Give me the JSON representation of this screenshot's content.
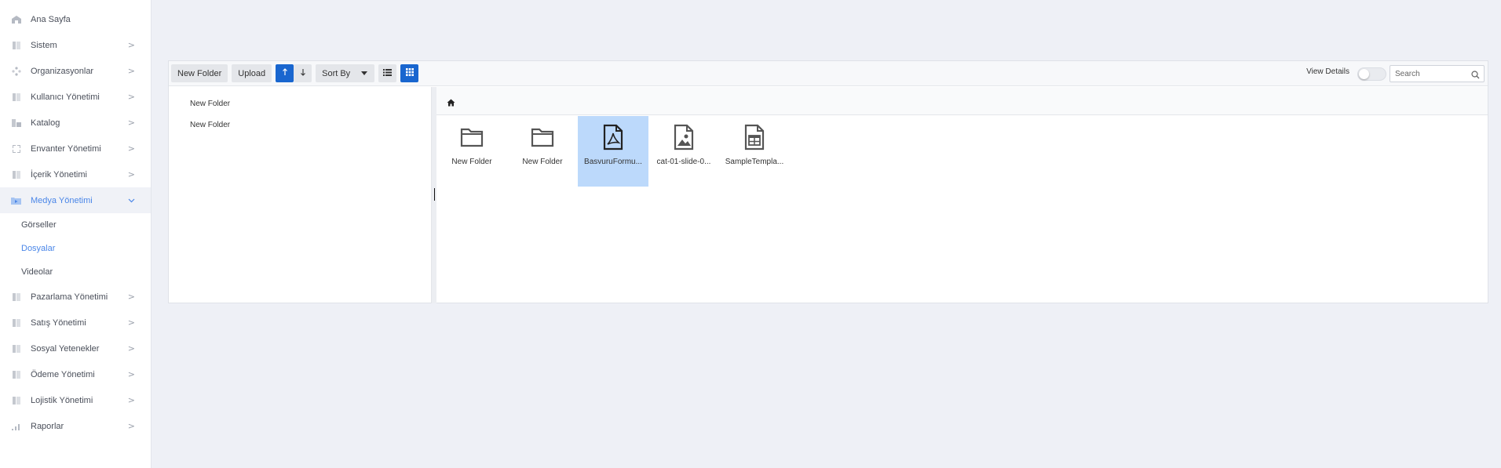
{
  "sidebar": {
    "items": [
      {
        "label": "Ana Sayfa",
        "icon": "home-icon",
        "chevron": ""
      },
      {
        "label": "Sistem",
        "icon": "system-icon",
        "chevron": ">"
      },
      {
        "label": "Organizasyonlar",
        "icon": "organization-icon",
        "chevron": ">"
      },
      {
        "label": "Kullanıcı Yönetimi",
        "icon": "users-icon",
        "chevron": ">"
      },
      {
        "label": "Katalog",
        "icon": "catalog-icon",
        "chevron": ">"
      },
      {
        "label": "Envanter Yönetimi",
        "icon": "inventory-icon",
        "chevron": ">"
      },
      {
        "label": "İçerik Yönetimi",
        "icon": "content-icon",
        "chevron": ">"
      },
      {
        "label": "Medya Yönetimi",
        "icon": "media-folder-icon",
        "chevron": "v"
      }
    ],
    "subitems": [
      {
        "label": "Görseller"
      },
      {
        "label": "Dosyalar"
      },
      {
        "label": "Videolar"
      }
    ],
    "items_after": [
      {
        "label": "Pazarlama Yönetimi",
        "icon": "marketing-icon",
        "chevron": ">"
      },
      {
        "label": "Satış Yönetimi",
        "icon": "sales-icon",
        "chevron": ">"
      },
      {
        "label": "Sosyal Yetenekler",
        "icon": "social-icon",
        "chevron": ">"
      },
      {
        "label": "Ödeme Yönetimi",
        "icon": "payment-icon",
        "chevron": ">"
      },
      {
        "label": "Lojistik Yönetimi",
        "icon": "logistics-icon",
        "chevron": ">"
      },
      {
        "label": "Raporlar",
        "icon": "reports-icon",
        "chevron": ">"
      }
    ],
    "accent_color": "#4a86e8"
  },
  "toolbar": {
    "new_folder": "New Folder",
    "upload": "Upload",
    "sort_by": "Sort By",
    "view_details": "View Details",
    "search_placeholder": "Search"
  },
  "tree": {
    "items": [
      {
        "label": "New Folder"
      },
      {
        "label": "New Folder"
      }
    ]
  },
  "files": [
    {
      "name": "New Folder",
      "type": "folder-icon"
    },
    {
      "name": "New Folder",
      "type": "folder-icon"
    },
    {
      "name": "BasvuruFormu...",
      "type": "pdf-file-icon"
    },
    {
      "name": "cat-01-slide-0...",
      "type": "image-file-icon"
    },
    {
      "name": "SampleTempla...",
      "type": "spreadsheet-file-icon"
    }
  ],
  "colors": {
    "primary_blue": "#1966cf",
    "selected_bg": "#bcd9fb",
    "page_bg": "#eef0f6"
  }
}
